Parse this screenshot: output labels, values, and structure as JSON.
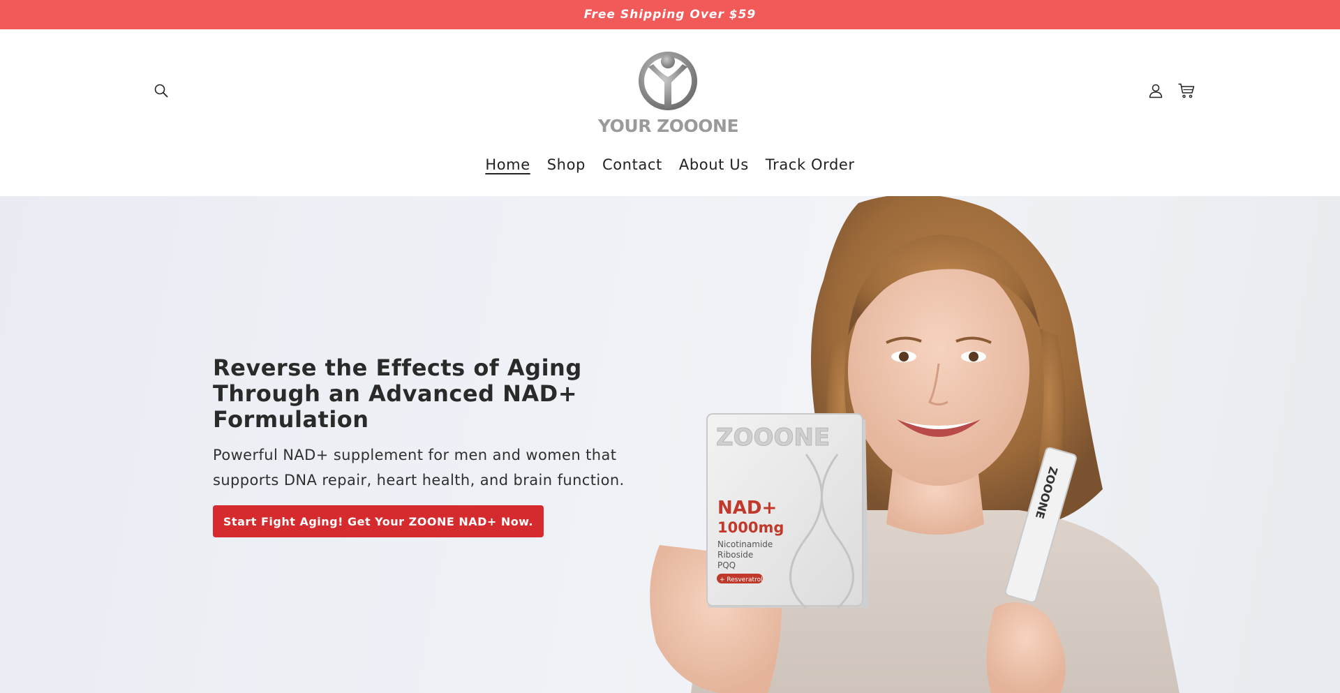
{
  "announcement": {
    "text": "Free Shipping Over $59"
  },
  "header": {
    "logo_text": "YOUR ZOOONE",
    "nav": [
      {
        "label": "Home",
        "active": true
      },
      {
        "label": "Shop",
        "active": false
      },
      {
        "label": "Contact",
        "active": false
      },
      {
        "label": "About Us",
        "active": false
      },
      {
        "label": "Track Order",
        "active": false
      }
    ],
    "icons": {
      "search": "search-icon",
      "account": "account-icon",
      "cart": "cart-icon"
    }
  },
  "hero": {
    "title": "Reverse the Effects of Aging Through an Advanced NAD+ Formulation",
    "subtitle": "Powerful NAD+ supplement for men and women that supports DNA repair, heart health, and brain function.",
    "cta_label": "Start Fight Aging! Get Your ZOONE NAD+ Now.",
    "product_box": {
      "brand": "ZOOONE",
      "name": "NAD+",
      "dose": "1000mg",
      "ingredients": [
        "Nicotinamide",
        "Riboside",
        "PQQ"
      ],
      "badge": "+ Resveratrol"
    },
    "product_stick": {
      "brand": "ZOOONE"
    }
  },
  "colors": {
    "announcement_bg": "#f25a5a",
    "cta_bg": "#d62b2e",
    "text_dark": "#222222",
    "logo_grey": "#9a9a9a"
  }
}
